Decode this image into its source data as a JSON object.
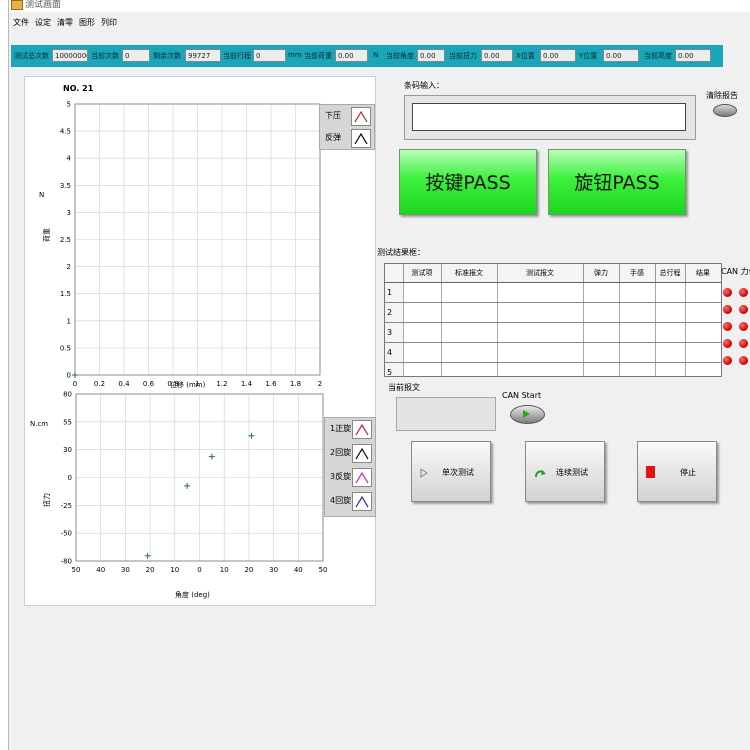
{
  "window": {
    "title": "测试画面"
  },
  "menu": [
    "文件",
    "设定",
    "清零",
    "图形",
    "列印"
  ],
  "status_fields": [
    {
      "label": "测试总次数",
      "value": "10000000",
      "unit": ""
    },
    {
      "label": "当前次数",
      "value": "0",
      "unit": ""
    },
    {
      "label": "剩余次数",
      "value": "99727",
      "unit": ""
    },
    {
      "label": "当前行程",
      "value": "0",
      "unit": "mm"
    },
    {
      "label": "当前荷重",
      "value": "0.00",
      "unit": "N"
    },
    {
      "label": "当前角度",
      "value": "0.00",
      "unit": ""
    },
    {
      "label": "当前扭力",
      "value": "0.00",
      "unit": ""
    },
    {
      "label": "X位置",
      "value": "0.00",
      "unit": ""
    },
    {
      "label": "Y位置",
      "value": "0.00",
      "unit": ""
    },
    {
      "label": "当前高度",
      "value": "0.00",
      "unit": ""
    }
  ],
  "colors": {
    "status_bar": "#1aa5b8",
    "pass_green": "#2fe52f",
    "led_red": "#d40000",
    "plot_points": "#2e6b4f"
  },
  "chart_data": [
    {
      "type": "line",
      "title": "NO. 21",
      "xlabel": "位移 (mm)",
      "ylabel": "荷重",
      "yunit": "N",
      "xlim": [
        0,
        2
      ],
      "ylim": [
        0,
        5
      ],
      "xticks": [
        "0",
        "0.2",
        "0.4",
        "0.6",
        "0.8",
        "1",
        "1.2",
        "1.4",
        "1.6",
        "1.8",
        "2"
      ],
      "yticks": [
        "0",
        "0.5",
        "1",
        "1.5",
        "2",
        "2.5",
        "3",
        "3.5",
        "4",
        "4.5",
        "5"
      ],
      "grid": true,
      "legend_position": "top-right",
      "series": [
        {
          "name": "下压",
          "color": "#b0232a",
          "x": [
            0
          ],
          "y": [
            0
          ]
        },
        {
          "name": "反弹",
          "color": "#000000",
          "x": [],
          "y": []
        }
      ]
    },
    {
      "type": "scatter",
      "xlabel": "角度 (deg)",
      "ylabel": "扭力",
      "yunit": "N.cm",
      "xlim": [
        -50,
        50
      ],
      "ylim": [
        -80,
        80
      ],
      "xticks": [
        "50",
        "40",
        "30",
        "20",
        "10",
        "0",
        "10",
        "20",
        "30",
        "40",
        "50"
      ],
      "yticks": [
        "80",
        "55",
        "30",
        "0",
        "-25",
        "-50",
        "-80"
      ],
      "grid": true,
      "legend_position": "top-right",
      "series": [
        {
          "name": "1正旋",
          "color": "#b0232a"
        },
        {
          "name": "2回旋",
          "color": "#000000"
        },
        {
          "name": "3反旋",
          "color": "#c81eb4"
        },
        {
          "name": "4回旋",
          "color": "#1f2a8a"
        }
      ],
      "points": [
        {
          "x": -21,
          "y": -75
        },
        {
          "x": -5,
          "y": -8
        },
        {
          "x": 5,
          "y": 20
        },
        {
          "x": 21,
          "y": 40
        }
      ]
    }
  ],
  "barcode": {
    "label": "条码输入：",
    "value": ""
  },
  "clear_report": {
    "label": "清除报告"
  },
  "buttons": {
    "key_pass": "按键PASS",
    "knob_pass": "旋钮PASS",
    "single_test": "单次测试",
    "continuous_test": "连续测试",
    "stop": "停止"
  },
  "results": {
    "label": "测试结果框：",
    "columns": [
      "测试项",
      "标准报文",
      "测试报文",
      "弹力",
      "手感",
      "总行程",
      "结果"
    ],
    "rows": [
      "1",
      "2",
      "3",
      "4",
      "5"
    ]
  },
  "can": {
    "label": "CAN 力值",
    "start_label": "CAN Start"
  },
  "current_message": {
    "label": "当前报文",
    "value": ""
  }
}
